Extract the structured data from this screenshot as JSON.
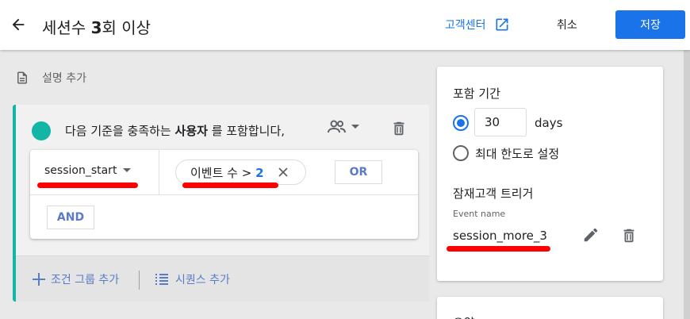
{
  "header": {
    "title_prefix": "세션수 ",
    "title_bold": "3",
    "title_suffix": "회 이상",
    "help_label": "고객센터",
    "cancel_label": "취소",
    "save_label": "저장"
  },
  "description": {
    "label": "설명 추가"
  },
  "condition_group": {
    "text_prefix": "다음 기준을 충족하는 ",
    "text_bold": "사용자",
    "text_suffix": " 를 포함합니다,",
    "event_name": "session_start",
    "chip_label": "이벤트 수 > ",
    "chip_value": "2",
    "or_label": "OR",
    "and_label": "AND",
    "add_group_label": "조건 그룹 추가",
    "add_sequence_label": "시퀀스 추가"
  },
  "membership": {
    "title": "포함 기간",
    "days_value": "30",
    "days_unit": "days",
    "max_label": "최대 한도로 설정"
  },
  "trigger": {
    "title": "잠재고객 트리거",
    "event_label": "Event name",
    "event_value": "session_more_3"
  },
  "summary": {
    "title": "요약"
  },
  "colors": {
    "accent": "#1a73e8",
    "group_bar": "#12b5a6",
    "marker": "#ff0000"
  }
}
